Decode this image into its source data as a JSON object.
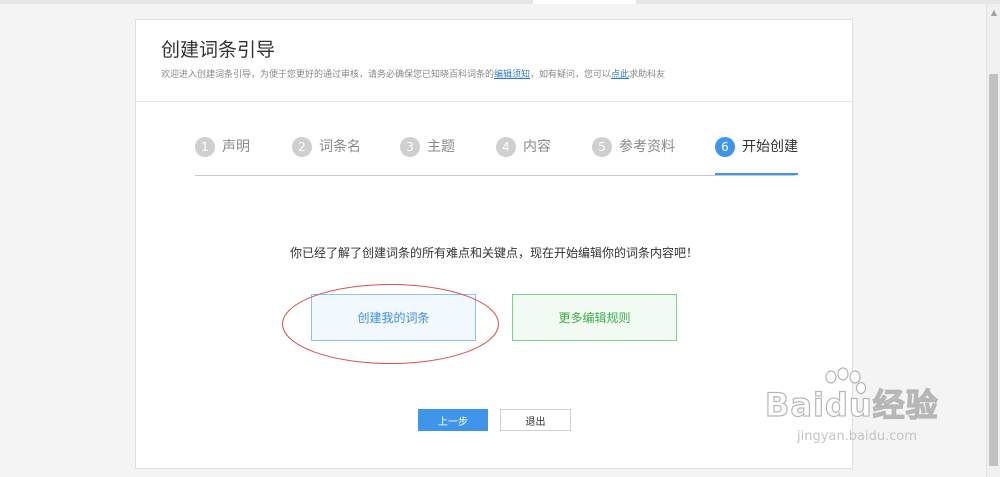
{
  "header": {
    "title": "创建词条引导",
    "subtitle_part1": "欢迎进入创建词条引导，为便于您更好的通过审核，请务必确保您已知晓百科词条的",
    "subtitle_link1": "编辑须知",
    "subtitle_part2": "，如有疑问，您可以",
    "subtitle_link2": "点此",
    "subtitle_part3": "求助科友"
  },
  "steps": [
    {
      "num": "1",
      "label": "声明"
    },
    {
      "num": "2",
      "label": "词条名"
    },
    {
      "num": "3",
      "label": "主题"
    },
    {
      "num": "4",
      "label": "内容"
    },
    {
      "num": "5",
      "label": "参考资料"
    },
    {
      "num": "6",
      "label": "开始创建",
      "active": true
    }
  ],
  "main": {
    "message": "你已经了解了创建词条的所有难点和关键点，现在开始编辑你的词条内容吧！",
    "create_label": "创建我的词条",
    "rules_label": "更多编辑规则"
  },
  "footer": {
    "prev_label": "上一步",
    "exit_label": "退出"
  },
  "watermark": {
    "title": "Baidu经验",
    "url": "jingyan.baidu.com"
  },
  "colors": {
    "accent": "#3e95ea",
    "green": "#3fae4b",
    "annotation": "#d9534f"
  }
}
